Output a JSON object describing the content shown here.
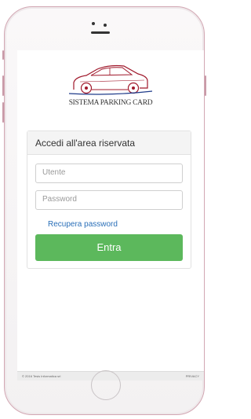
{
  "brand": {
    "title": "SISTEMA PARKING CARD"
  },
  "login": {
    "heading": "Accedi all'area riservata",
    "username_placeholder": "Utente",
    "password_placeholder": "Password",
    "recover_label": "Recupera password",
    "submit_label": "Entra"
  },
  "footer": {
    "copyright": "© 2016 Tesis Informatica srl",
    "privacy": "PRIVACY"
  },
  "colors": {
    "accent_button": "#5cb85c",
    "link": "#2a6fb8",
    "logo_red": "#a0182b"
  },
  "icons": [
    "car-logo-icon",
    "home-button-icon"
  ]
}
